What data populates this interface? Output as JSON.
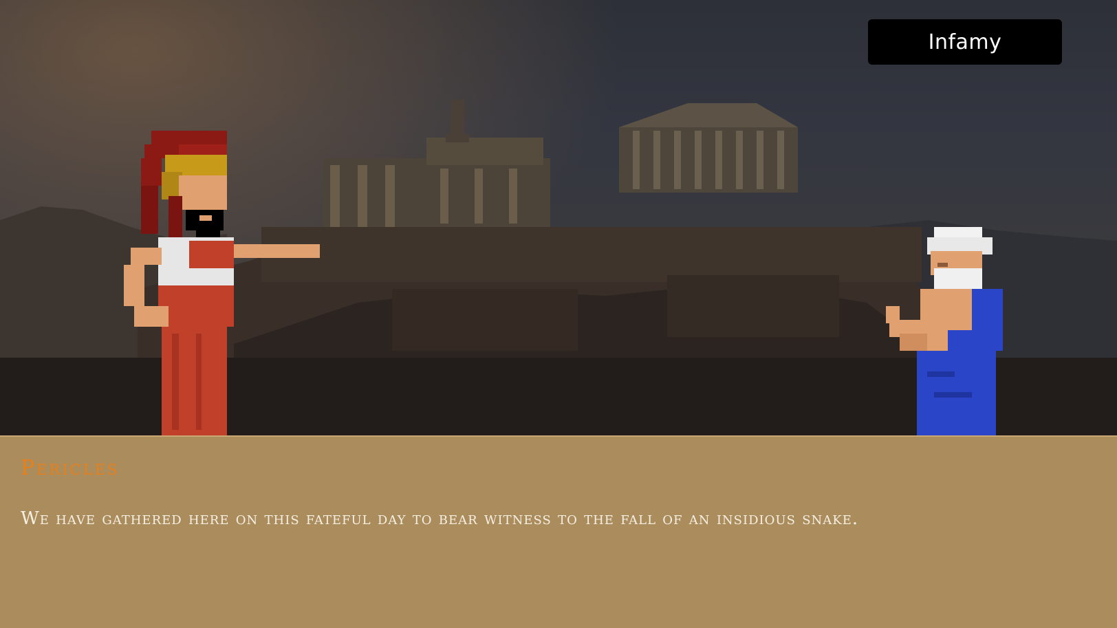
{
  "hud": {
    "infamy_label": "Infamy"
  },
  "dialogue": {
    "speaker": "Pericles",
    "text": "We have gathered here on this fateful day to bear witness to the fall of an insidious snake."
  },
  "scene": {
    "background": "acropolis-at-dusk",
    "characters": [
      "pericles-sprite",
      "old-philosopher-sprite"
    ]
  },
  "colors": {
    "dialogue_bg": "#b08f5e",
    "speaker_name": "#e8801a",
    "dialogue_text": "#f6efe3",
    "button_bg": "#000000",
    "pericles_robe": "#c0402a",
    "philosopher_robe": "#2b45c8"
  }
}
